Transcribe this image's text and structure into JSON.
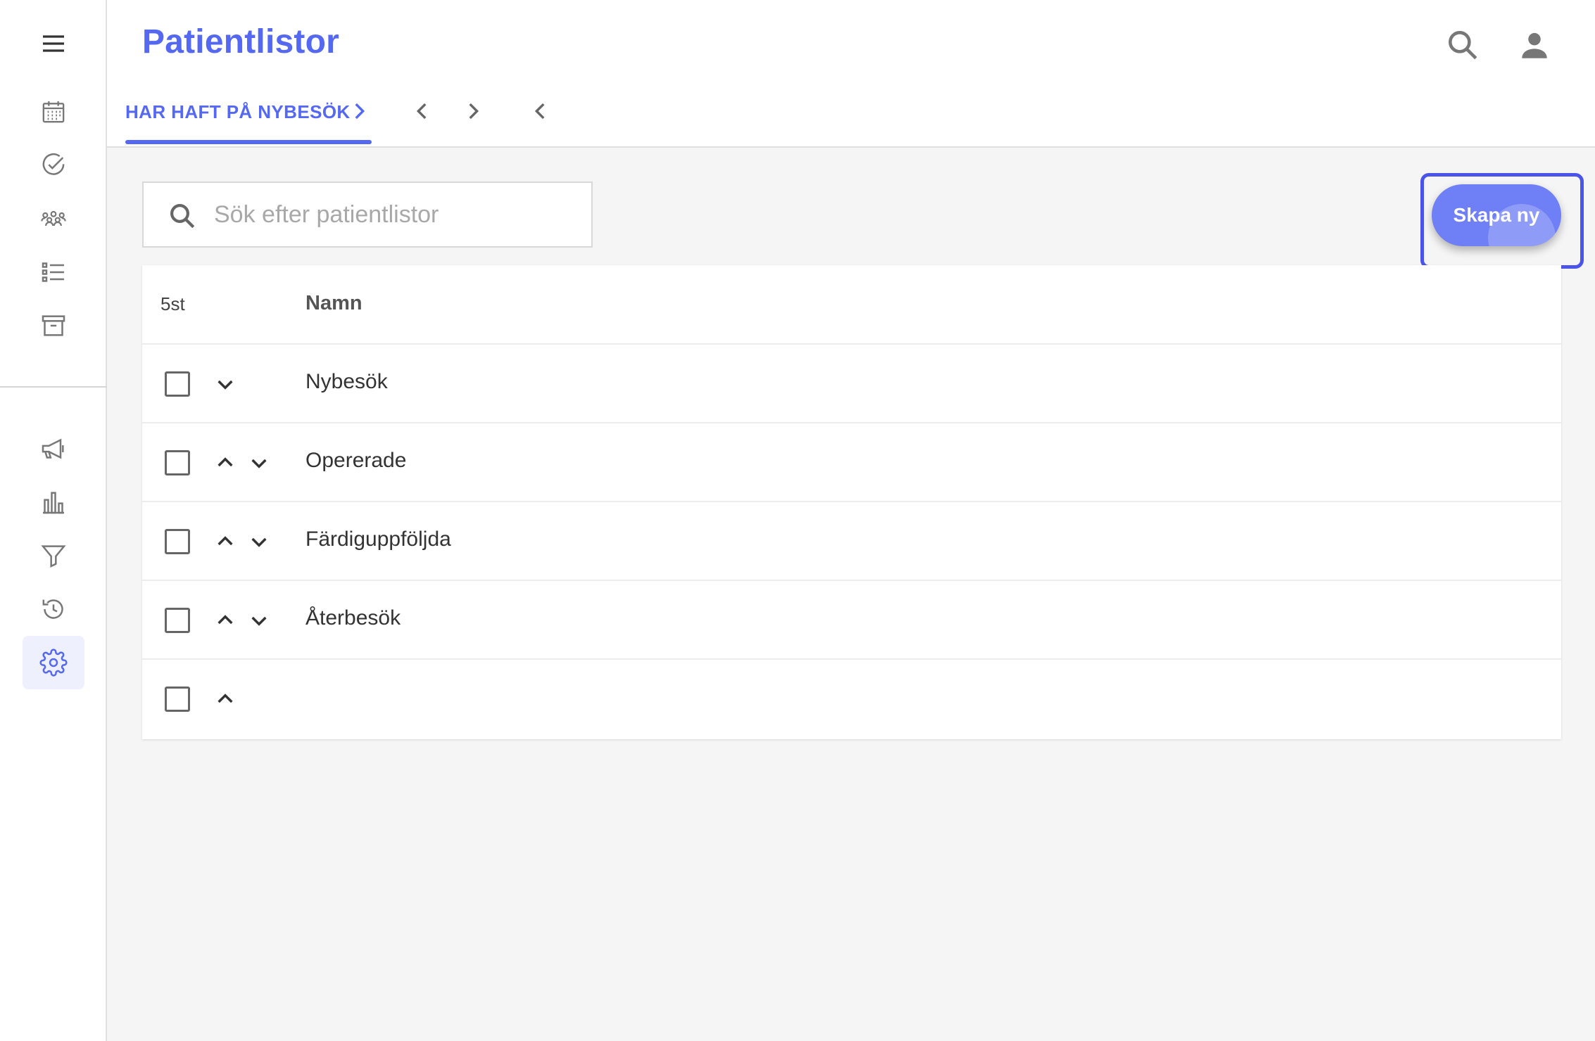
{
  "colors": {
    "accent": "#5468f2",
    "button_bg": "#6f7ff5",
    "focus_ring": "#4a54ea",
    "page_bg": "#f5f5f5",
    "icon_gray": "#777777"
  },
  "sidebar": {
    "top_items": [
      {
        "icon": "menu-icon"
      },
      {
        "icon": "calendar-icon"
      },
      {
        "icon": "check-circle-icon"
      },
      {
        "icon": "group-icon"
      },
      {
        "icon": "list-icon"
      },
      {
        "icon": "archive-icon"
      }
    ],
    "bottom_items": [
      {
        "icon": "megaphone-icon"
      },
      {
        "icon": "bar-chart-icon"
      },
      {
        "icon": "filter-icon"
      },
      {
        "icon": "history-icon"
      },
      {
        "icon": "settings-icon",
        "active": true
      }
    ]
  },
  "header": {
    "title": "Patientlistor",
    "search_icon": "search-icon",
    "account_icon": "account-icon"
  },
  "tabs": {
    "active_label": "HAR HAFT PÅ NYBESÖK"
  },
  "search": {
    "placeholder": "Sök efter patientlistor",
    "value": ""
  },
  "create_button": {
    "label": "Skapa ny"
  },
  "table": {
    "count": "5st",
    "column_name": "Namn",
    "rows": [
      {
        "name": "Nybesök",
        "checked": false,
        "can_move_up": false,
        "can_move_down": true
      },
      {
        "name": "Opererade",
        "checked": false,
        "can_move_up": true,
        "can_move_down": true
      },
      {
        "name": "Färdiguppföljda",
        "checked": false,
        "can_move_up": true,
        "can_move_down": true
      },
      {
        "name": "Återbesök",
        "checked": false,
        "can_move_up": true,
        "can_move_down": true
      },
      {
        "name": "",
        "checked": false,
        "can_move_up": true,
        "can_move_down": false
      }
    ]
  }
}
